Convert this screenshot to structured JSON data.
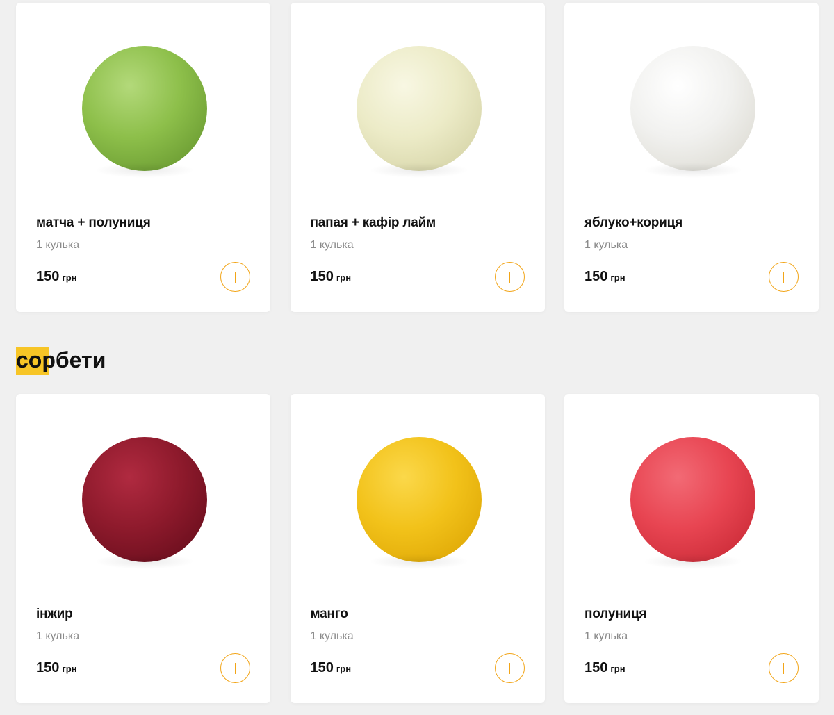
{
  "top_products": [
    {
      "title": "матча + полуниця",
      "subtitle": "1 кулька",
      "price": "150",
      "currency": "грн",
      "scoop": {
        "icon": "matcha-scoop-image",
        "color": "#8dbf4a",
        "light": "#b3d97a",
        "dark": "#5f8f2a"
      }
    },
    {
      "title": "папая + кафір лайм",
      "subtitle": "1 кулька",
      "price": "150",
      "currency": "грн",
      "scoop": {
        "icon": "papaya-scoop-image",
        "color": "#ecebc7",
        "light": "#f8f7e3",
        "dark": "#cfcd9e"
      }
    },
    {
      "title": "яблуко+кориця",
      "subtitle": "1 кулька",
      "price": "150",
      "currency": "грн",
      "scoop": {
        "icon": "apple-cinnamon-scoop-image",
        "color": "#f1f1ef",
        "light": "#ffffff",
        "dark": "#d8d6cc"
      }
    }
  ],
  "section": {
    "title": "сорбети"
  },
  "bottom_products": [
    {
      "title": "інжир",
      "subtitle": "1 кулька",
      "price": "150",
      "currency": "грн",
      "scoop": {
        "icon": "fig-scoop-image",
        "color": "#8e1a2c",
        "light": "#b02a40",
        "dark": "#5e0a18"
      }
    },
    {
      "title": "манго",
      "subtitle": "1 кулька",
      "price": "150",
      "currency": "грн",
      "scoop": {
        "icon": "mango-scoop-image",
        "color": "#f2c21a",
        "light": "#fbd84a",
        "dark": "#d9a000"
      }
    },
    {
      "title": "полуниця",
      "subtitle": "1 кулька",
      "price": "150",
      "currency": "грн",
      "scoop": {
        "icon": "strawberry-scoop-image",
        "color": "#e84552",
        "light": "#f26a75",
        "dark": "#c2232f"
      }
    }
  ],
  "colors": {
    "accent": "#f2a518",
    "highlight": "#f7c526",
    "page_bg": "#f0f0f0",
    "card_bg": "#ffffff"
  }
}
